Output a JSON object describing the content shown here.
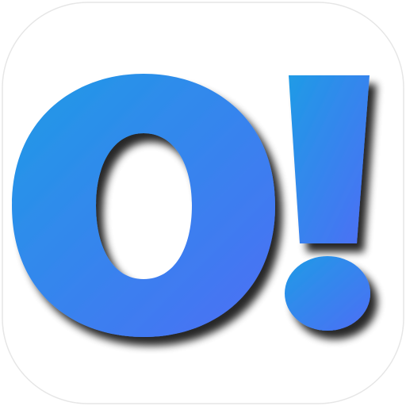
{
  "app_icon": {
    "name": "O! app icon",
    "logo_text": "O!",
    "colors": {
      "background": "#ffffff",
      "icon_border": "#e6e6e6",
      "gradient_start": "#1f9be6",
      "gradient_end": "#4d6ef5",
      "shadow": "#111111"
    }
  }
}
